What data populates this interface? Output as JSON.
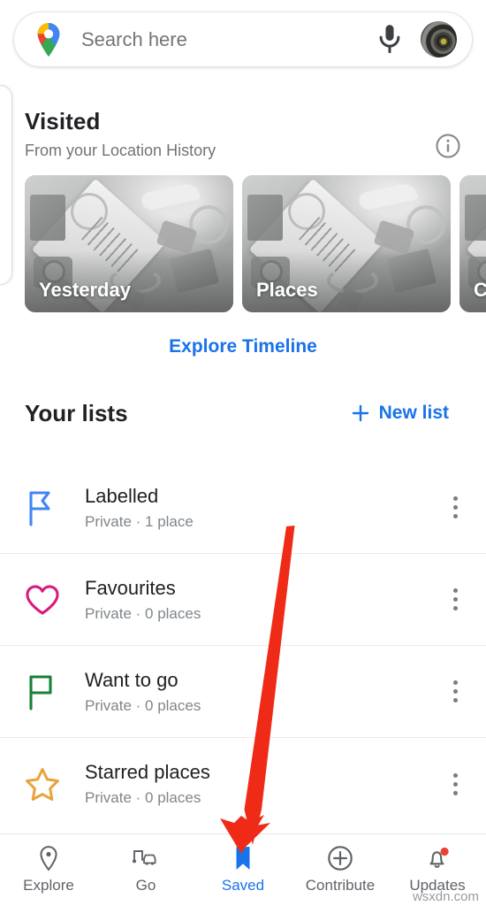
{
  "search": {
    "placeholder": "Search here",
    "value": "",
    "logo_icon": "google-maps-pin-icon",
    "mic_icon": "microphone-icon",
    "avatar_icon": "user-avatar"
  },
  "visited": {
    "title": "Visited",
    "subtitle": "From your Location History",
    "info_icon": "info-icon",
    "cards": [
      {
        "label": "Yesterday"
      },
      {
        "label": "Places"
      },
      {
        "label": "C"
      }
    ],
    "explore_link": "Explore Timeline"
  },
  "your_lists": {
    "title": "Your lists",
    "new_list_label": "New list",
    "new_list_icon": "plus-icon",
    "rows": [
      {
        "name": "Labelled",
        "meta": "Private · 1 place",
        "icon": "flag-icon",
        "color": "#4285f4",
        "menu_icon": "overflow-menu-icon"
      },
      {
        "name": "Favourites",
        "meta": "Private · 0 places",
        "icon": "heart-icon",
        "color": "#d81b7e",
        "menu_icon": "overflow-menu-icon"
      },
      {
        "name": "Want to go",
        "meta": "Private · 0 places",
        "icon": "flag-icon",
        "color": "#188038",
        "menu_icon": "overflow-menu-icon"
      },
      {
        "name": "Starred places",
        "meta": "Private · 0 places",
        "icon": "star-icon",
        "color": "#e8a33d",
        "menu_icon": "overflow-menu-icon"
      }
    ]
  },
  "bottom_nav": {
    "items": [
      {
        "label": "Explore",
        "icon": "map-pin-icon",
        "active": false
      },
      {
        "label": "Go",
        "icon": "directions-icon",
        "active": false
      },
      {
        "label": "Saved",
        "icon": "bookmark-icon",
        "active": true
      },
      {
        "label": "Contribute",
        "icon": "plus-circle-icon",
        "active": false
      },
      {
        "label": "Updates",
        "icon": "bell-icon",
        "active": false,
        "badge": true
      }
    ],
    "active_color": "#1a73e8",
    "inactive_color": "#5f6368"
  },
  "annotation": {
    "arrow_color": "#ef2b17",
    "points_to": "Saved"
  },
  "watermark": "wsxdn.com"
}
